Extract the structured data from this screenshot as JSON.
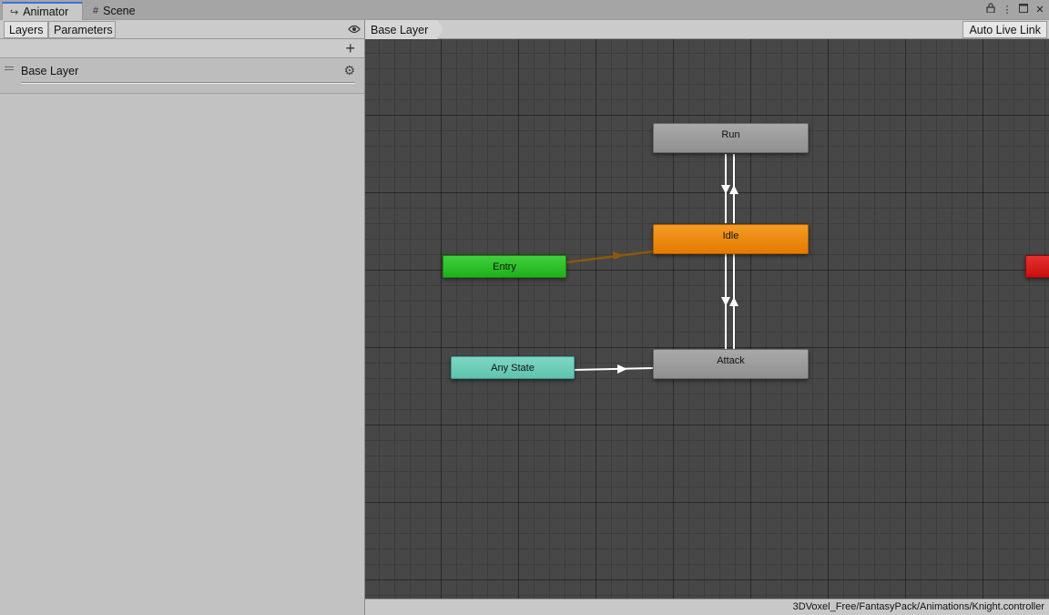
{
  "tabs": [
    {
      "label": "Animator",
      "icon": "animator-icon",
      "active": true
    },
    {
      "label": "Scene",
      "icon": "grid-icon",
      "active": false
    }
  ],
  "window_icons": [
    "lock-icon",
    "more-icon",
    "maximize-icon",
    "close-icon"
  ],
  "left_panel": {
    "subtabs": [
      {
        "label": "Layers",
        "active": true
      },
      {
        "label": "Parameters",
        "active": false
      }
    ],
    "layers": [
      {
        "name": "Base Layer"
      }
    ]
  },
  "graph": {
    "breadcrumb": "Base Layer",
    "auto_live_link_label": "Auto Live Link",
    "states": {
      "run": "Run",
      "idle": "Idle",
      "attack": "Attack",
      "entry": "Entry",
      "any_state": "Any State",
      "exit": ""
    },
    "colors": {
      "grid_background": "#474747",
      "default_state": "#ef8a10",
      "entry": "#2ec42a",
      "any_state": "#6ccab6",
      "exit": "#d81f1f",
      "state": "#9c9c9c",
      "default_transition": "#8a5a0a",
      "transition": "#ffffff"
    }
  },
  "status_bar": {
    "asset_path": "3DVoxel_Free/FantasyPack/Animations/Knight.controller"
  }
}
